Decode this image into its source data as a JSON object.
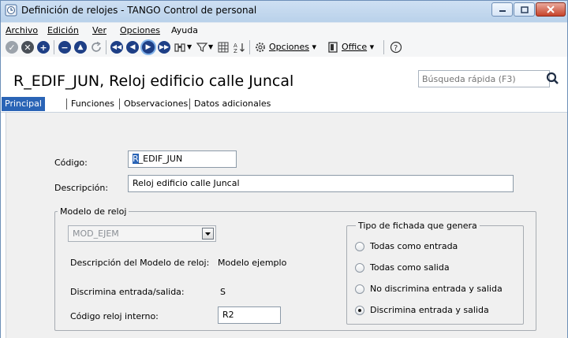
{
  "window": {
    "title": "Definición de relojes - TANGO Control de personal"
  },
  "menu": {
    "items": [
      "Archivo",
      "Edición",
      "Ver",
      "Opciones",
      "Ayuda"
    ]
  },
  "toolbar": {
    "opciones_label": "Opciones",
    "office_label": "Office",
    "icons": [
      "check-icon",
      "cancel-icon",
      "add-icon",
      "remove-icon",
      "warning-icon",
      "refresh-icon",
      "first-icon",
      "previous-icon",
      "next-icon",
      "last-icon",
      "binoculars-icon",
      "filter-icon",
      "grid-icon",
      "sort-icon",
      "gear-icon",
      "office-icon",
      "help-icon"
    ]
  },
  "header": {
    "record_title": "R_EDIF_JUN, Reloj edificio calle Juncal",
    "search_placeholder": "Búsqueda rápida (F3)"
  },
  "tabs": [
    "Principal",
    "Funciones",
    "Observaciones",
    "Datos adicionales"
  ],
  "form": {
    "codigo_label": "Código:",
    "codigo_value_selected": "R",
    "codigo_value_rest": "_EDIF_JUN",
    "descripcion_label": "Descripción:",
    "descripcion_value": "Reloj edificio calle Juncal",
    "modelo_group_title": "Modelo de reloj",
    "modelo_value": "MOD_EJEM",
    "desc_modelo_label": "Descripción del Modelo de reloj:",
    "desc_modelo_value": "Modelo ejemplo",
    "discrimina_label": "Discrimina entrada/salida:",
    "discrimina_value": "S",
    "codigo_interno_label": "Código reloj interno:",
    "codigo_interno_value": "R2",
    "fichada_group_title": "Tipo de fichada que genera",
    "fichada_options": [
      {
        "label": "Todas como entrada",
        "selected": false
      },
      {
        "label": "Todas como salida",
        "selected": false
      },
      {
        "label": "No discrimina entrada y salida",
        "selected": false
      },
      {
        "label": "Discrimina entrada y salida",
        "selected": true
      }
    ]
  },
  "colors": {
    "accent": "#2a64b6",
    "titlebar": "#c4d8ee",
    "close_button": "#c7432a"
  }
}
